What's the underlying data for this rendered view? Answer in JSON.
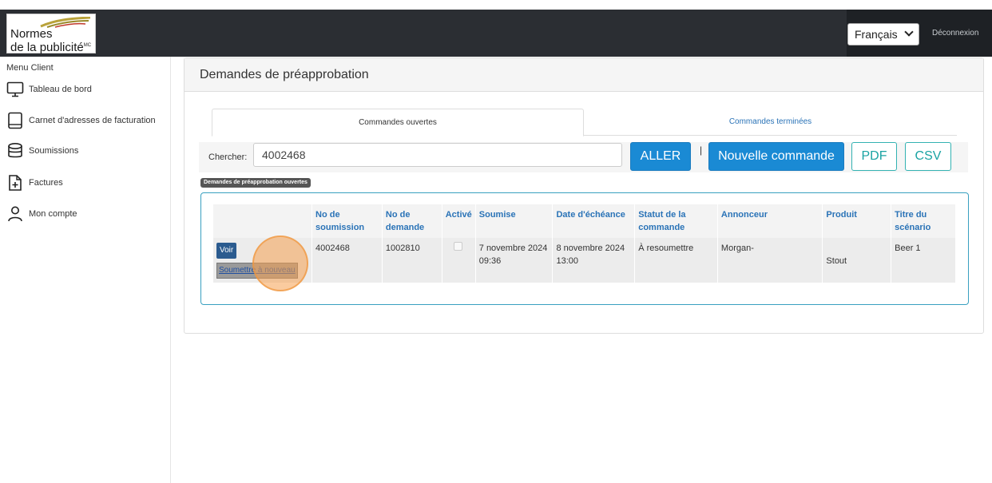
{
  "header": {
    "logo_line1": "Normes",
    "logo_line2": "de la publicité",
    "logo_mark": "MC",
    "language_selected": "Français",
    "logout_label": "Déconnexion"
  },
  "sidebar": {
    "title": "Menu Client",
    "items": [
      {
        "label": "Tableau de bord",
        "icon": "monitor-icon"
      },
      {
        "label": "Carnet d'adresses de facturation",
        "icon": "tablet-icon"
      },
      {
        "label": "Soumissions",
        "icon": "database-icon"
      },
      {
        "label": "Factures",
        "icon": "file-plus-icon"
      },
      {
        "label": "Mon compte",
        "icon": "user-icon"
      }
    ]
  },
  "main": {
    "title": "Demandes de préapprobation",
    "tabs": [
      {
        "label": "Commandes ouvertes",
        "active": true
      },
      {
        "label": "Commandes terminées",
        "active": false
      }
    ],
    "search": {
      "label": "Chercher:",
      "value": "4002468"
    },
    "buttons": {
      "go": "ALLER",
      "separator": "|",
      "new_order": "Nouvelle commande",
      "pdf": "PDF",
      "csv": "CSV"
    },
    "section_badge": "Demandes de préapprobation ouvertes",
    "table": {
      "headers": [
        "",
        "No de soumission",
        "No de demande",
        "Activé",
        "Soumise",
        "Date d'échéance",
        "Statut de la commande",
        "Annonceur",
        "Produit",
        "Titre du scénario"
      ],
      "rows": [
        {
          "view_label": "Voir",
          "resubmit_label": "Soumettre à nouveau",
          "submission_no": "4002468",
          "request_no": "1002810",
          "active": false,
          "submitted": "7 novembre 2024 09:36",
          "due_date": "8 novembre 2024 13:00",
          "status": "À resoumettre",
          "advertiser": "Morgan-",
          "product": "Stout",
          "scenario_title": "Beer 1"
        }
      ]
    }
  },
  "colors": {
    "topbar": "#2b2e33",
    "primary_button": "#1a8ad4",
    "link": "#2a73b7",
    "outline_button": "#33b2b2"
  }
}
